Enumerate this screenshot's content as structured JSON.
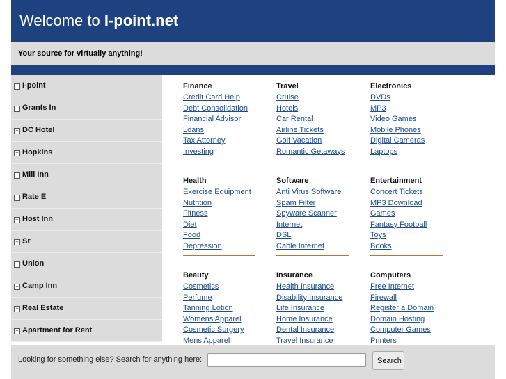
{
  "header": {
    "title_prefix": "Welcome to ",
    "title_site": "I-point.net",
    "tagline": "Your source for virtually anything!"
  },
  "sidebar": [
    "I-point",
    "Grants In",
    "DC Hotel",
    "Hopkins",
    "Mill Inn",
    "Rate E",
    "Host Inn",
    "Sr",
    "Union",
    "Camp Inn",
    "Real Estate",
    "Apartment for Rent"
  ],
  "sections": [
    {
      "title": "Finance",
      "links": [
        "Credit Card Help",
        "Debt Consolidation",
        "Financial Advisor",
        "Loans",
        "Tax Attorney",
        "Investing"
      ]
    },
    {
      "title": "Travel",
      "links": [
        "Cruise",
        "Hotels",
        "Car Rental",
        "Airline Tickets",
        "Golf Vacation",
        "Romantic Getaways"
      ]
    },
    {
      "title": "Electronics",
      "links": [
        "DVDs",
        "MP3",
        "Video Games",
        "Mobile Phones",
        "Digital Cameras",
        "Laptops"
      ]
    },
    {
      "title": "Health",
      "links": [
        "Exercise Equipment",
        "Nutrition",
        "Fitness",
        "Diet",
        "Food",
        "Depression"
      ]
    },
    {
      "title": "Software",
      "links": [
        "Anti Virus Software",
        "Spam Filter",
        "Spyware Scanner",
        "Internet",
        "DSL",
        "Cable Internet"
      ]
    },
    {
      "title": "Entertainment",
      "links": [
        "Concert Tickets",
        "MP3 Download",
        "Games",
        "Fantasy Football",
        "Toys",
        "Books"
      ]
    },
    {
      "title": "Beauty",
      "links": [
        "Cosmetics",
        "Perfume",
        "Tanning Lotion",
        "Womens Apparel",
        "Cosmetic Surgery",
        "Mens Apparel"
      ]
    },
    {
      "title": "Insurance",
      "links": [
        "Health Insurance",
        "Disability Insurance",
        "Life Insurance",
        "Home Insurance",
        "Dental Insurance",
        "Travel Insurance"
      ]
    },
    {
      "title": "Computers",
      "links": [
        "Free Internet",
        "Firewall",
        "Register a Domain",
        "Domain Hosting",
        "Computer Games",
        "Printers"
      ]
    }
  ],
  "footer": {
    "label": "Looking for something else? Search for anything here:",
    "search_value": "",
    "button": "Search"
  }
}
